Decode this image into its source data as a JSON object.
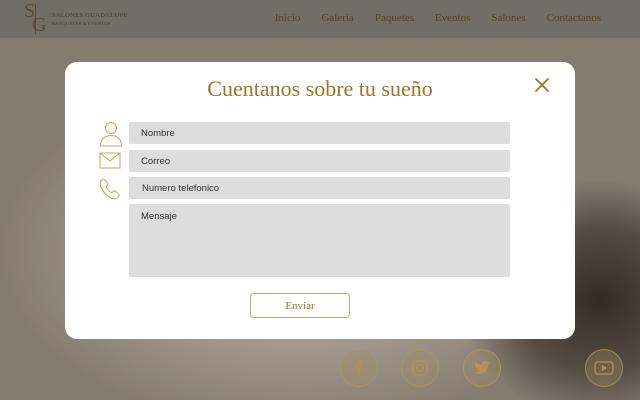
{
  "header": {
    "logo": {
      "monogram_s": "S",
      "monogram_g": "G",
      "name": "SALONES GUADALUPE",
      "tagline": "BANQUETES & EVENTOS"
    },
    "nav": [
      {
        "label": "Inicio"
      },
      {
        "label": "Galeria"
      },
      {
        "label": "Paquetes"
      },
      {
        "label": "Eventos"
      },
      {
        "label": "Salones"
      },
      {
        "label": "Contactanos"
      }
    ]
  },
  "modal": {
    "title": "Cuentanos sobre tu sueño",
    "fields": {
      "name_placeholder": "Nombre",
      "email_placeholder": "Correo",
      "phone_placeholder": "Numero telefonico",
      "message_placeholder": "Mensaje"
    },
    "submit_label": "Enviar"
  },
  "icons": {
    "close": "close-icon",
    "user": "user-icon",
    "mail": "mail-icon",
    "phone": "phone-icon",
    "social": [
      "facebook-icon",
      "instagram-icon",
      "twitter-icon",
      "youtube-icon"
    ]
  },
  "colors": {
    "accent_gold": "#9a7626",
    "nav_text": "#6b4e1e",
    "field_bg": "#dddddd",
    "modal_bg": "#ffffff"
  }
}
